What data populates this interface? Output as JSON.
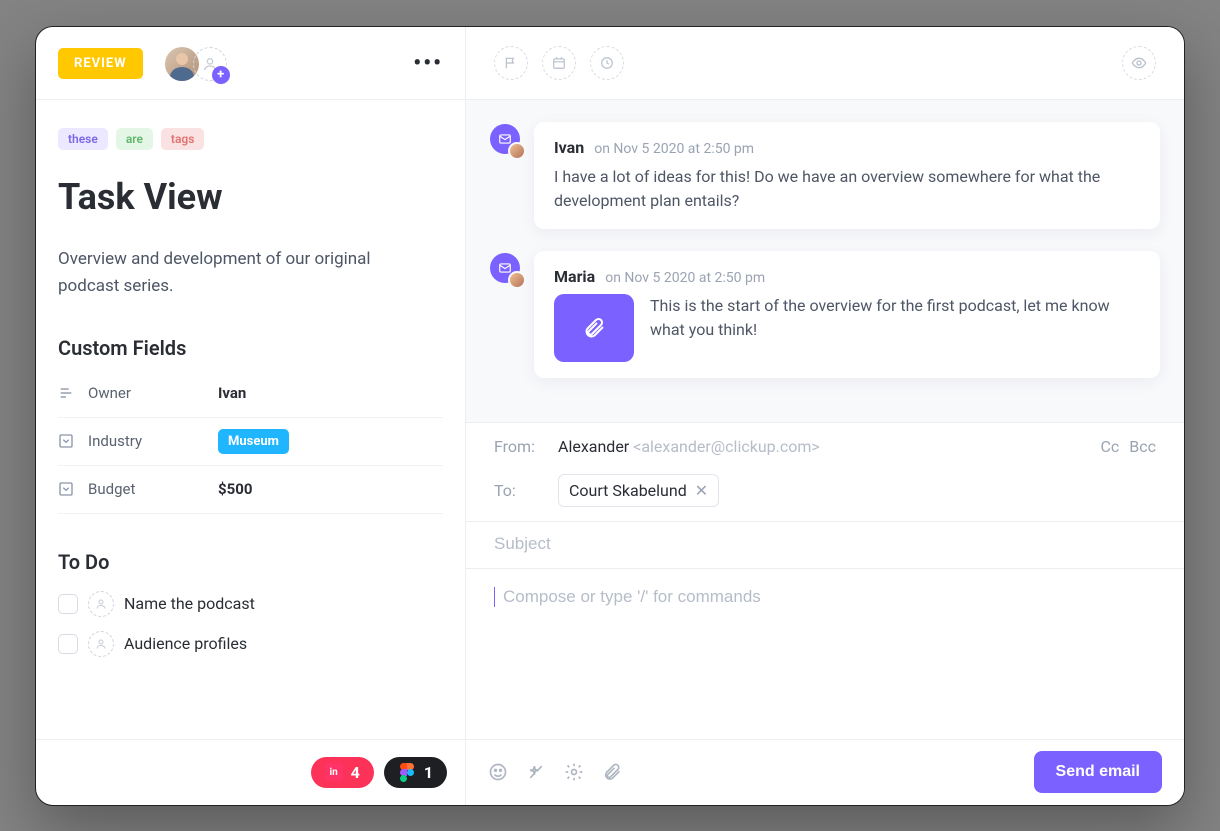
{
  "left": {
    "status_label": "REVIEW",
    "tags": [
      {
        "text": "these",
        "cls": "purple"
      },
      {
        "text": "are",
        "cls": "green"
      },
      {
        "text": "tags",
        "cls": "pink"
      }
    ],
    "title": "Task View",
    "description": "Overview and development of our original podcast series.",
    "custom_fields_heading": "Custom Fields",
    "custom_fields": [
      {
        "icon": "text",
        "label": "Owner",
        "value": "Ivan",
        "type": "text"
      },
      {
        "icon": "dropdown",
        "label": "Industry",
        "value": "Museum",
        "type": "pill"
      },
      {
        "icon": "dropdown",
        "label": "Budget",
        "value": "$500",
        "type": "text"
      }
    ],
    "todo_heading": "To Do",
    "todos": [
      {
        "text": "Name the podcast"
      },
      {
        "text": "Audience profiles"
      }
    ],
    "footer_counts": {
      "invision": "4",
      "figma": "1"
    }
  },
  "thread": [
    {
      "author": "Ivan",
      "meta": "on Nov 5 2020 at 2:50 pm",
      "body": "I have a lot of ideas for this! Do we have an overview somewhere for what the development plan entails?",
      "attachment": false
    },
    {
      "author": "Maria",
      "meta": "on Nov 5 2020 at 2:50 pm",
      "body": "This is the start of the overview for the first podcast, let me know what you think!",
      "attachment": true
    }
  ],
  "compose": {
    "from_label": "From:",
    "from_name": "Alexander",
    "from_email": "<alexander@clickup.com>",
    "cc_label": "Cc",
    "bcc_label": "Bcc",
    "to_label": "To:",
    "to_chip": "Court Skabelund",
    "subject_placeholder": "Subject",
    "body_placeholder": "Compose or type '/' for commands",
    "send_label": "Send email"
  }
}
